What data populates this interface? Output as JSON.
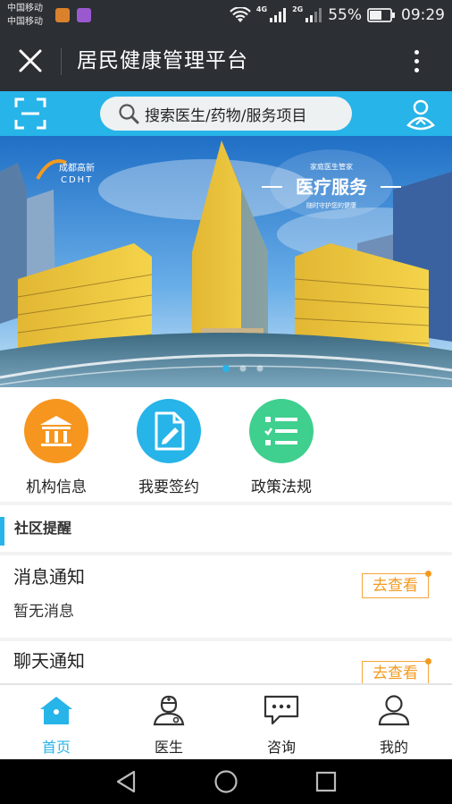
{
  "status_bar": {
    "carriers": [
      "中国移动",
      "中国移动"
    ],
    "network_labels": [
      "4G",
      "2G"
    ],
    "battery": "55%",
    "time": "09:29"
  },
  "title_bar": {
    "title": "居民健康管理平台"
  },
  "search": {
    "placeholder": "搜索医生/药物/服务项目"
  },
  "banner": {
    "logo_cn": "成都高新",
    "logo_en": "CDHT",
    "badge_top": "家庭医生管家",
    "badge_main": "医疗服务",
    "badge_sub": "随时守护您的健康",
    "slide_count": 3,
    "active_slide": 1
  },
  "quick_menu": [
    {
      "label": "机构信息",
      "icon": "institution-icon",
      "color": "#f7961e"
    },
    {
      "label": "我要签约",
      "icon": "sign-document-icon",
      "color": "#27b4e8"
    },
    {
      "label": "政策法规",
      "icon": "policy-list-icon",
      "color": "#3fcf8e"
    }
  ],
  "community": {
    "section_title": "社区提醒",
    "notices": [
      {
        "title": "消息通知",
        "subtitle": "暂无消息",
        "action": "去查看"
      },
      {
        "title": "聊天通知",
        "subtitle": "",
        "action": "去查看"
      }
    ]
  },
  "tabs": [
    {
      "label": "首页",
      "icon": "home-icon",
      "active": true
    },
    {
      "label": "医生",
      "icon": "doctor-icon",
      "active": false
    },
    {
      "label": "咨询",
      "icon": "chat-icon",
      "active": false
    },
    {
      "label": "我的",
      "icon": "user-icon",
      "active": false
    }
  ],
  "colors": {
    "accent": "#27b4e8",
    "status_bar": "#2c2f34",
    "orange": "#f39a1f"
  }
}
